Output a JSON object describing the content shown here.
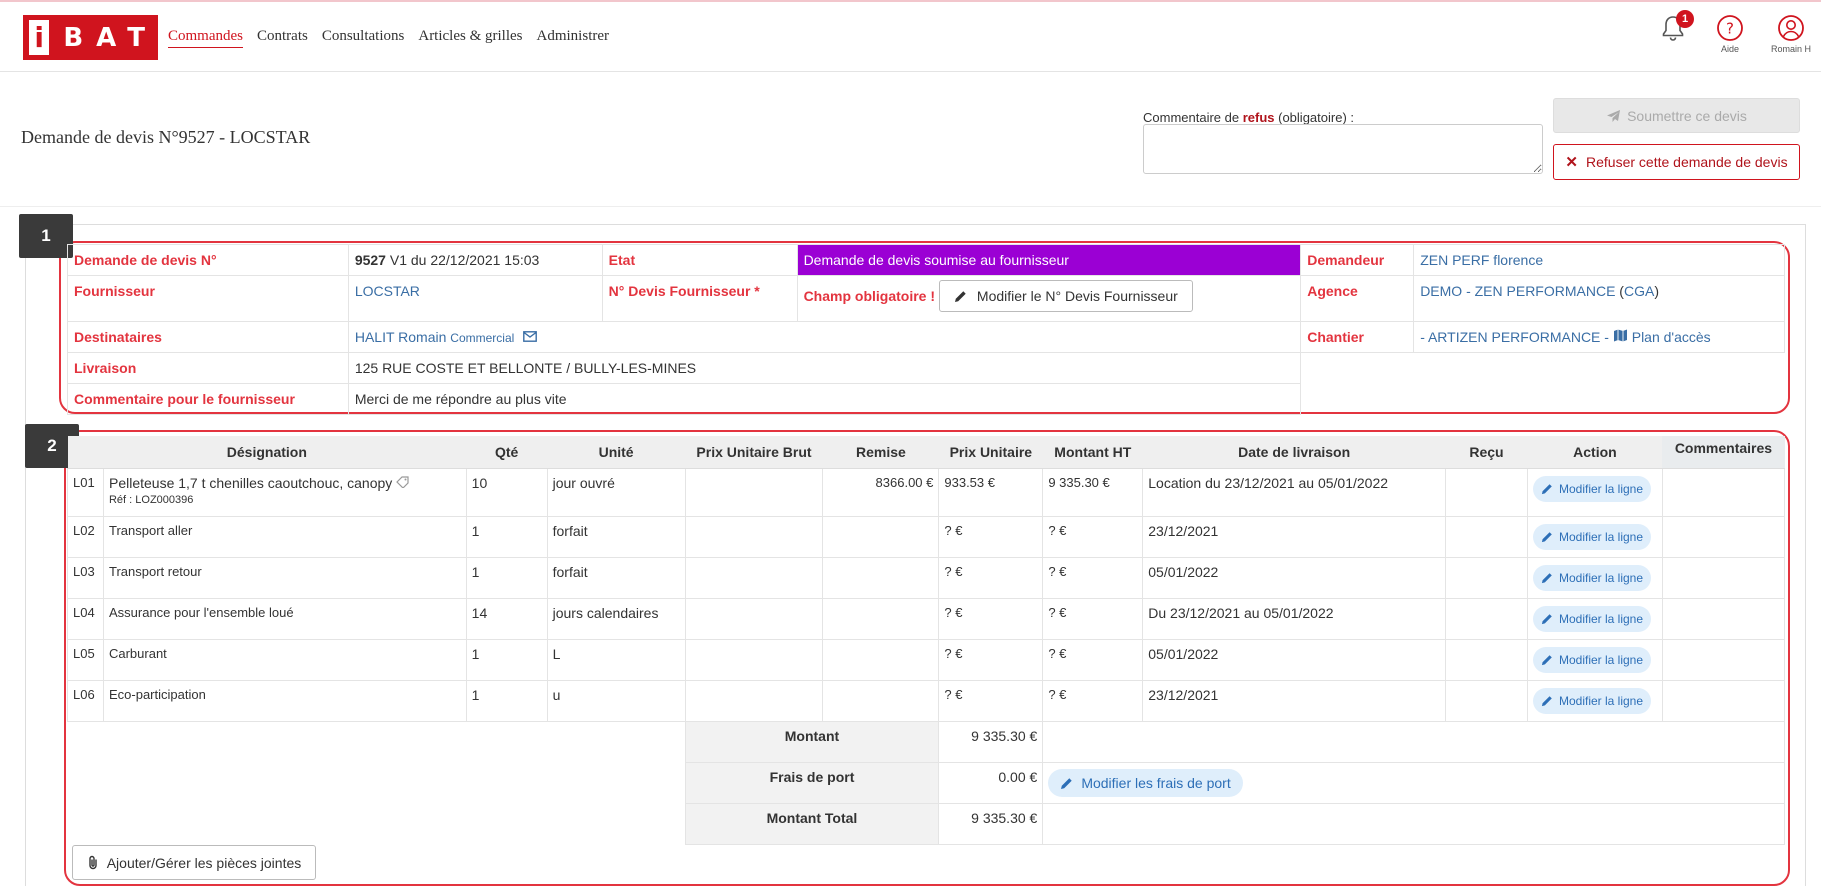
{
  "logo": {
    "first": "i",
    "rest": "BAT"
  },
  "nav": {
    "items": [
      "Commandes",
      "Contrats",
      "Consultations",
      "Articles & grilles",
      "Administrer"
    ]
  },
  "top": {
    "badge_count": "1",
    "help_label": "Aide",
    "user_label": "Romain H"
  },
  "page": {
    "title": "Demande de devis N°9527 - LOCSTAR"
  },
  "refus": {
    "label_prefix": "Commentaire de ",
    "label_bold": "refus",
    "label_suffix": " (obligatoire) :",
    "submit_label": "Soumettre ce devis",
    "refuse_label": "Refuser cette demande de devis"
  },
  "sections": {
    "one": "1",
    "two": "2"
  },
  "info": {
    "demande_label": "Demande de devis N°",
    "demande_num": "9527",
    "demande_rest": " V1 du 22/12/2021 15:03",
    "etat_label": "Etat",
    "etat_value": "Demande de devis soumise au fournisseur",
    "demandeur_label": "Demandeur",
    "demandeur_value": "ZEN PERF florence",
    "fournisseur_label": "Fournisseur",
    "fournisseur_value": "LOCSTAR",
    "ndevis_label": "N° Devis Fournisseur *",
    "champ_obligatoire": "Champ obligatoire !",
    "modifier_ndevis": "Modifier le N° Devis Fournisseur",
    "agence_label": "Agence",
    "agence_value": "DEMO - ZEN PERFORMANCE",
    "agence_code": "CGA",
    "destinataires_label": "Destinataires",
    "destinataire_name": "HALIT Romain",
    "destinataire_role": "Commercial",
    "chantier_label": "Chantier",
    "chantier_value": "- ARTIZEN PERFORMANCE -",
    "plan_acces": "Plan d'accès",
    "livraison_label": "Livraison",
    "livraison_value": "125 RUE COSTE ET BELLONTE / BULLY-LES-MINES",
    "commentaire_label": "Commentaire pour le fournisseur",
    "commentaire_value": "Merci de me répondre au plus vite"
  },
  "table": {
    "headers": [
      "Désignation",
      "Qté",
      "Unité",
      "Prix Unitaire Brut",
      "Remise",
      "Prix Unitaire",
      "Montant HT",
      "Date de livraison",
      "Reçu",
      "Action",
      "Commentaires"
    ],
    "action_label": "Modifier la ligne",
    "rows": [
      {
        "id": "L01",
        "designation": "Pelleteuse 1,7 t chenilles caoutchouc, canopy",
        "ref": "Réf : LOZ000396",
        "qte": "10",
        "unite": "jour ouvré",
        "prix_brut": "",
        "remise": "8366.00 €",
        "prix_unitaire": "933.53 €",
        "montant": "9 335.30 €",
        "date": "Location du 23/12/2021 au 05/01/2022"
      },
      {
        "id": "L02",
        "designation": "Transport aller",
        "ref": "",
        "qte": "1",
        "unite": "forfait",
        "prix_brut": "",
        "remise": "",
        "prix_unitaire": "? €",
        "montant": "? €",
        "date": "23/12/2021"
      },
      {
        "id": "L03",
        "designation": "Transport retour",
        "ref": "",
        "qte": "1",
        "unite": "forfait",
        "prix_brut": "",
        "remise": "",
        "prix_unitaire": "? €",
        "montant": "? €",
        "date": "05/01/2022"
      },
      {
        "id": "L04",
        "designation": "Assurance pour l'ensemble loué",
        "ref": "",
        "qte": "14",
        "unite": "jours calendaires",
        "prix_brut": "",
        "remise": "",
        "prix_unitaire": "? €",
        "montant": "? €",
        "date": "Du 23/12/2021 au 05/01/2022"
      },
      {
        "id": "L05",
        "designation": "Carburant",
        "ref": "",
        "qte": "1",
        "unite": "L",
        "prix_brut": "",
        "remise": "",
        "prix_unitaire": "? €",
        "montant": "? €",
        "date": "05/01/2022"
      },
      {
        "id": "L06",
        "designation": "Eco-participation",
        "ref": "",
        "qte": "1",
        "unite": "u",
        "prix_brut": "",
        "remise": "",
        "prix_unitaire": "? €",
        "montant": "? €",
        "date": "23/12/2021"
      }
    ],
    "totals": {
      "montant_label": "Montant",
      "montant_value": "9 335.30 €",
      "frais_label": "Frais de port",
      "frais_value": "0.00 €",
      "frais_button": "Modifier les frais de port",
      "total_label": "Montant Total",
      "total_value": "9 335.30 €"
    }
  },
  "attachments": {
    "label": "Ajouter/Gérer les pièces jointes"
  },
  "colors": {
    "brand": "#d0141e",
    "etat_bg": "#9b00d4",
    "link": "#3a6ea5",
    "annotation": "#e3343f"
  }
}
